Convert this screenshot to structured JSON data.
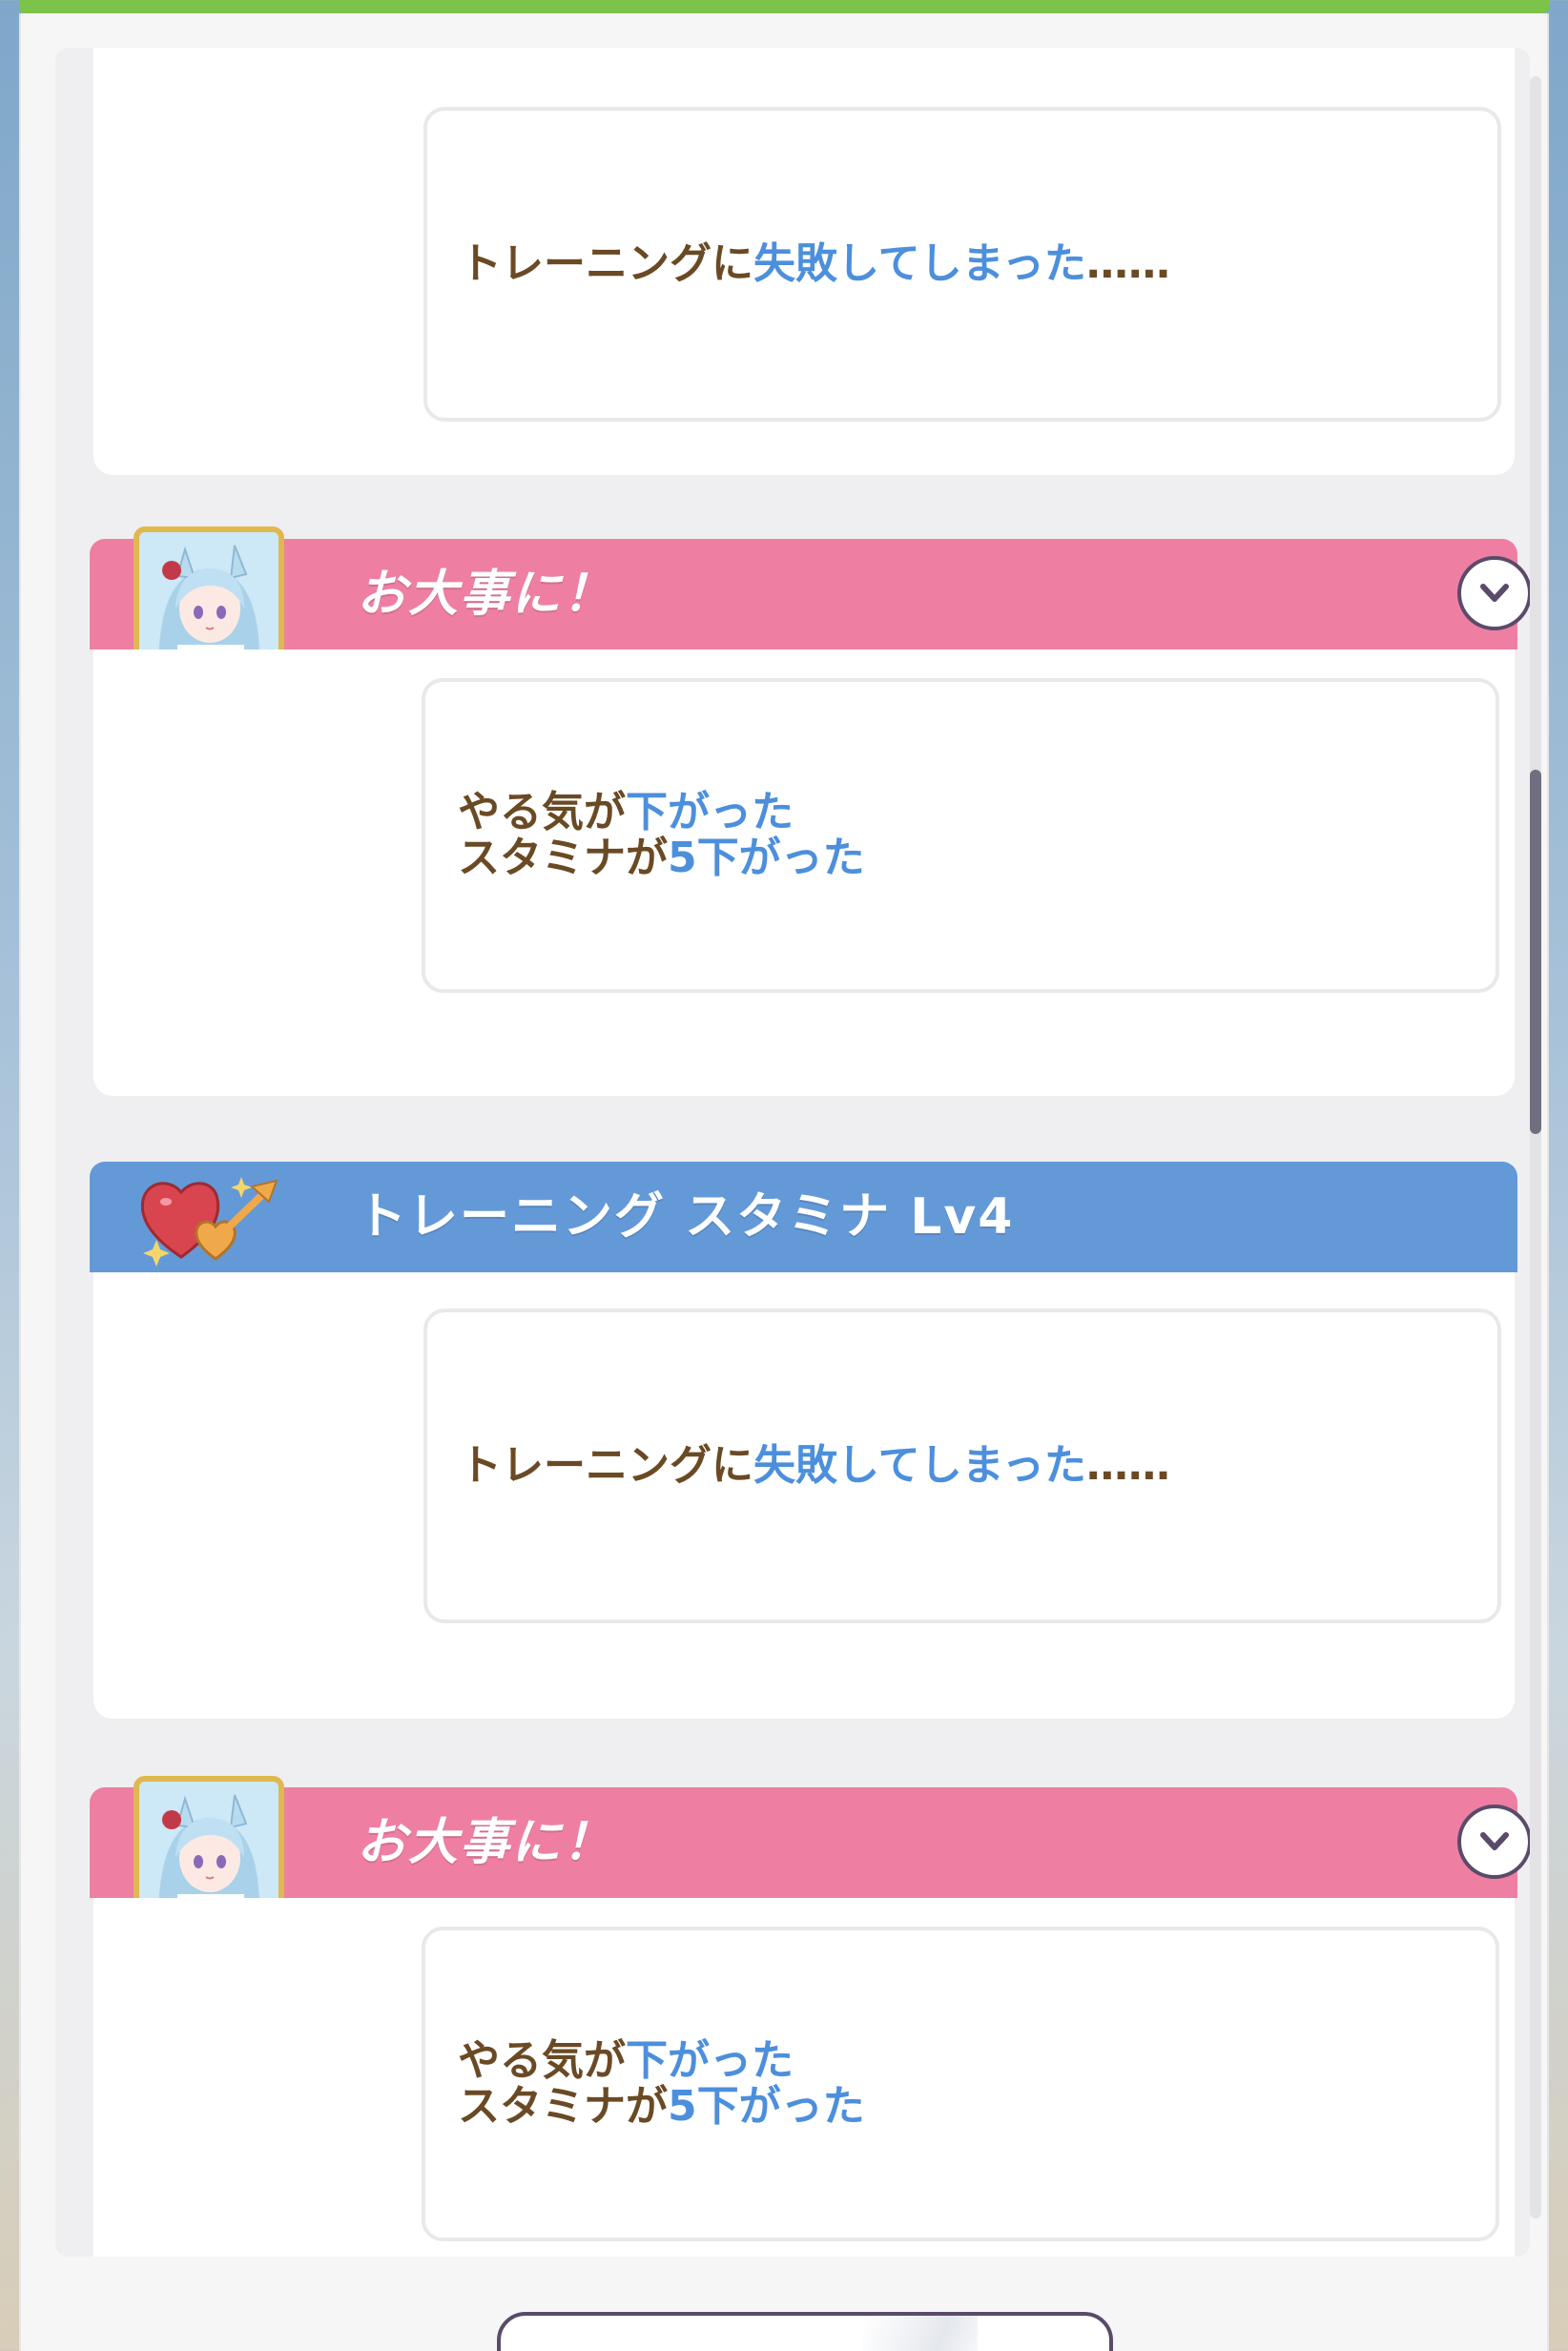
{
  "colors": {
    "pink_header": "#ee7fa3",
    "blue_header": "#6499d8",
    "highlight_text": "#4c8fdc",
    "body_text": "#6a4a24",
    "top_bar": "#7cc34a"
  },
  "entries": [
    {
      "type": "result",
      "lines": [
        [
          {
            "text": "トレーニングに",
            "hl": false
          },
          {
            "text": "失敗してしまった",
            "hl": true
          },
          {
            "text": "……",
            "hl": false
          }
        ]
      ]
    },
    {
      "type": "event",
      "title": "お大事に！",
      "header_color": "pink",
      "icon": "character-portrait",
      "lines": [
        [
          {
            "text": "やる気が",
            "hl": false
          },
          {
            "text": "下がった",
            "hl": true
          }
        ],
        [
          {
            "text": "スタミナが",
            "hl": false
          },
          {
            "text": "5下がった",
            "hl": true
          }
        ]
      ]
    },
    {
      "type": "training",
      "title": "トレーニング スタミナ Lv4",
      "header_color": "blue",
      "icon": "heart-arrow-icon",
      "lines": [
        [
          {
            "text": "トレーニングに",
            "hl": false
          },
          {
            "text": "失敗してしまった",
            "hl": true
          },
          {
            "text": "……",
            "hl": false
          }
        ]
      ]
    },
    {
      "type": "event",
      "title": "お大事に！",
      "header_color": "pink",
      "icon": "character-portrait",
      "lines": [
        [
          {
            "text": "やる気が",
            "hl": false
          },
          {
            "text": "下がった",
            "hl": true
          }
        ],
        [
          {
            "text": "スタミナが",
            "hl": false
          },
          {
            "text": "5下がった",
            "hl": true
          }
        ]
      ]
    }
  ]
}
